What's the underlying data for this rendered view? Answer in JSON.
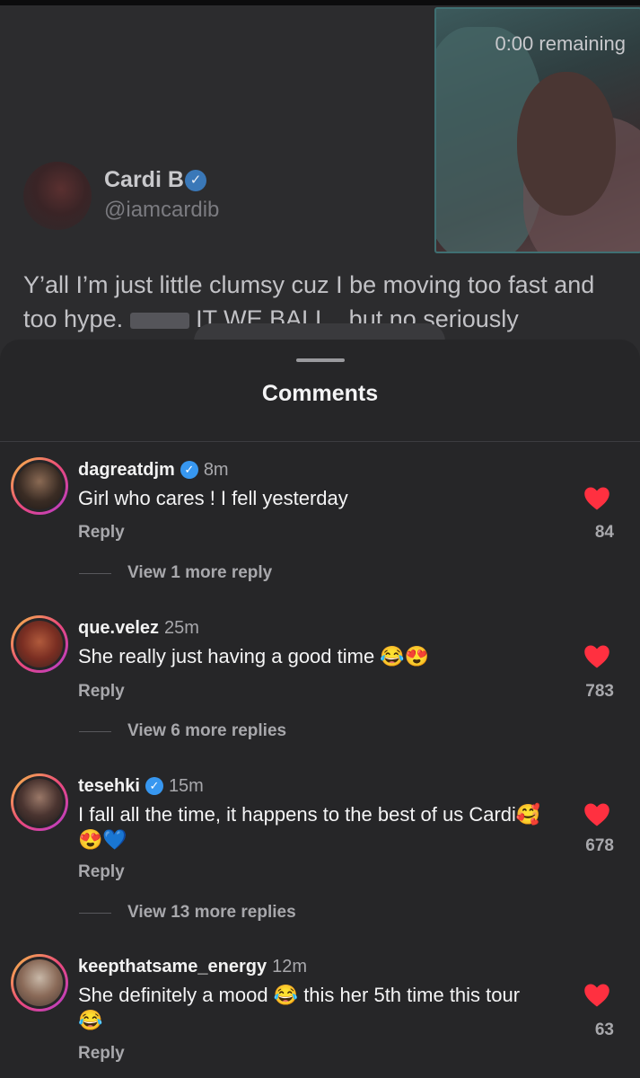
{
  "video": {
    "remaining": "0:00 remaining"
  },
  "tweet": {
    "name": "Cardi B",
    "handle": "@iamcardib",
    "text_before": "Y’all I’m just little clumsy cuz I be moving too fast and too hype.",
    "text_after": "IT WE BALL.. but no seriously"
  },
  "sheet": {
    "title": "Comments"
  },
  "comments": [
    {
      "username": "dagreatdjm",
      "verified": true,
      "time": "8m",
      "text": "Girl who cares ! I fell yesterday",
      "reply": "Reply",
      "likes": "84",
      "more": "View 1 more reply"
    },
    {
      "username": "que.velez",
      "verified": false,
      "time": "25m",
      "text": "She really just having a good time 😂😍",
      "reply": "Reply",
      "likes": "783",
      "more": "View 6 more replies"
    },
    {
      "username": "tesehki",
      "verified": true,
      "time": "15m",
      "text": "I fall all the time, it happens to the best of us Cardi🥰😍💙",
      "reply": "Reply",
      "likes": "678",
      "more": "View 13 more replies"
    },
    {
      "username": "keepthatsame_energy",
      "verified": false,
      "time": "12m",
      "text": "She definitely a mood 😂 this her 5th time this tour 😂",
      "reply": "Reply",
      "likes": "63"
    }
  ],
  "colors": {
    "background": "#262628",
    "like_heart": "#ff3040",
    "verified_badge": "#3797f0",
    "secondary_text": "#a8a8ac"
  }
}
